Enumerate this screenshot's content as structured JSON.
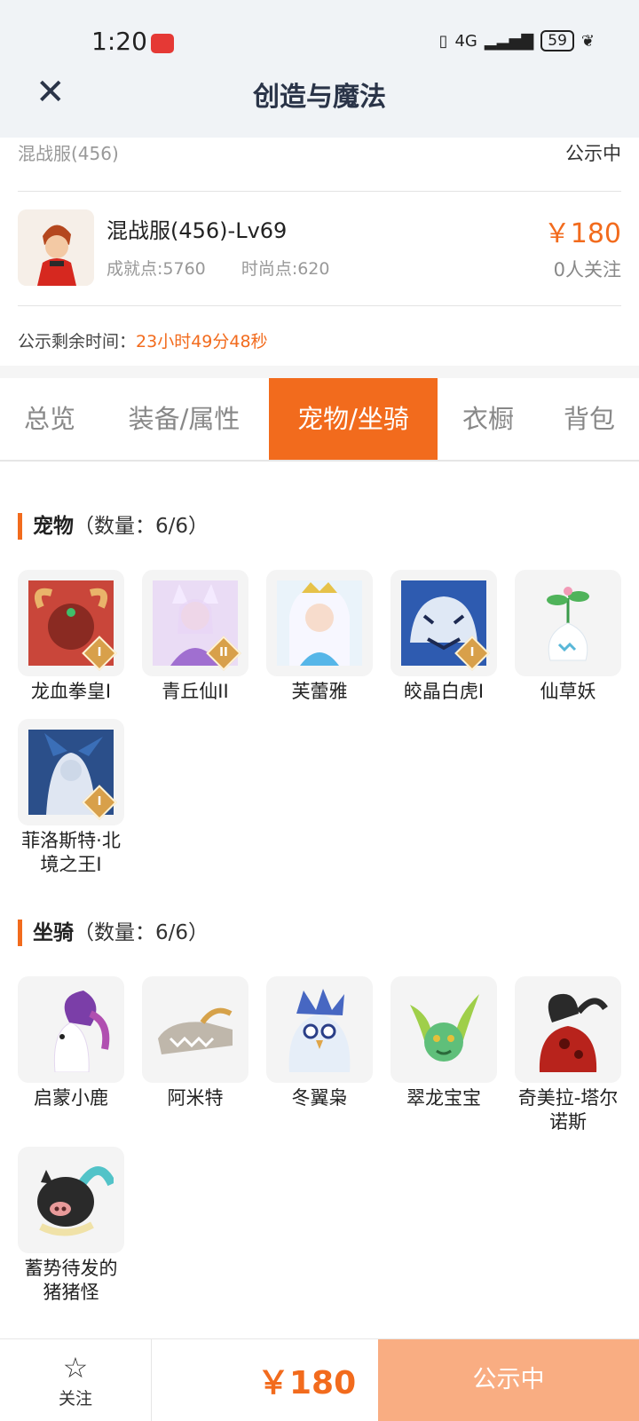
{
  "status_bar": {
    "time": "1:20",
    "network": "4G",
    "battery": "59"
  },
  "header": {
    "title": "创造与魔法",
    "close_icon": "close-icon"
  },
  "server": {
    "name": "混战服(456)",
    "state": "公示中"
  },
  "character": {
    "name": "混战服(456)-Lv69",
    "achievement": "成就点:5760",
    "fashion": "时尚点:620",
    "price": "￥180",
    "followers": "0人关注"
  },
  "countdown": {
    "label": "公示剩余时间：",
    "value": "23小时49分48秒"
  },
  "tabs": [
    {
      "label": "总览"
    },
    {
      "label": "装备/属性"
    },
    {
      "label": "宠物/坐骑"
    },
    {
      "label": "衣橱"
    },
    {
      "label": "背包"
    }
  ],
  "active_tab": "宠物/坐骑",
  "pets": {
    "title": "宠物",
    "count": "（数量：6/6）",
    "items": [
      {
        "name": "龙血拳皇Ⅰ",
        "grade": "I"
      },
      {
        "name": "青丘仙II",
        "grade": "II"
      },
      {
        "name": "芙蕾雅",
        "grade": ""
      },
      {
        "name": "皎晶白虎Ⅰ",
        "grade": "I"
      },
      {
        "name": "仙草妖",
        "grade": ""
      },
      {
        "name": "菲洛斯特·北境之王I",
        "grade": "I"
      }
    ]
  },
  "mounts": {
    "title": "坐骑",
    "count": "（数量：6/6）",
    "items": [
      {
        "name": "启蒙小鹿"
      },
      {
        "name": "阿米特"
      },
      {
        "name": "冬翼枭"
      },
      {
        "name": "翠龙宝宝"
      },
      {
        "name": "奇美拉-塔尔诺斯"
      },
      {
        "name": "蓄势待发的猪猪怪"
      }
    ]
  },
  "bottom": {
    "follow_label": "关注",
    "price": "￥180",
    "status_button": "公示中"
  },
  "colors": {
    "accent": "#f26b1d",
    "status_button": "#f9ad82"
  }
}
